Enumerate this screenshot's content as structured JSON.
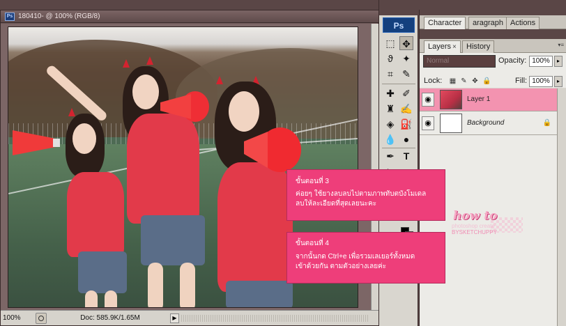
{
  "document": {
    "title": "180410- @ 100% (RGB/8)",
    "zoom": "100%",
    "doc_size": "Doc: 585.9K/1.65M"
  },
  "tools_panel": {
    "logo": "Ps",
    "tool_icons": [
      "rectangular-marquee-icon",
      "move-icon",
      "lasso-icon",
      "magic-wand-icon",
      "crop-icon",
      "eyedropper-icon",
      "healing-brush-icon",
      "brush-icon",
      "clone-stamp-icon",
      "history-brush-icon",
      "eraser-icon",
      "paint-bucket-icon",
      "blur-icon",
      "dodge-icon",
      "pen-icon",
      "type-icon"
    ],
    "colors": {
      "foreground": "#000000",
      "background": "#ffffff"
    }
  },
  "panels": {
    "top_tabs": [
      "Character",
      "aragraph",
      "Actions"
    ],
    "layer_tabs": [
      {
        "label": "Layers",
        "close": "×"
      },
      {
        "label": "History"
      }
    ],
    "blend_mode": "Normal",
    "opacity_label": "Opacity:",
    "opacity_value": "100%",
    "lock_label": "Lock:",
    "fill_label": "Fill:",
    "fill_value": "100%",
    "layers": [
      {
        "name": "Layer 1",
        "selected": true
      },
      {
        "name": "Background",
        "selected": false,
        "locked": true
      }
    ]
  },
  "annotations": [
    {
      "heading": "ขั้นตอนที่ 3",
      "line1": "ค่อยๆ ใช้ยางลบลบไปตามภาพทับตบังโมเดล",
      "line2": "ลบให้ละเอียดที่สุดเลยนะคะ"
    },
    {
      "heading": "ขั้นตอนที่ 4",
      "line1": "จากนั้นกด Ctrl+e เพื่อรวมเลเยอร์ทั้งหมด",
      "line2": "เข้าด้วยกัน ตามตัวอย่างเลยค่ะ"
    }
  ],
  "watermark": {
    "title": "how to",
    "line1": "photoshop create",
    "line2": "BYSKETCHUPPY"
  },
  "colors": {
    "annotation_bg": "#ee3e7a",
    "selected_layer": "#f393b0",
    "app_frame": "#5a4646"
  }
}
